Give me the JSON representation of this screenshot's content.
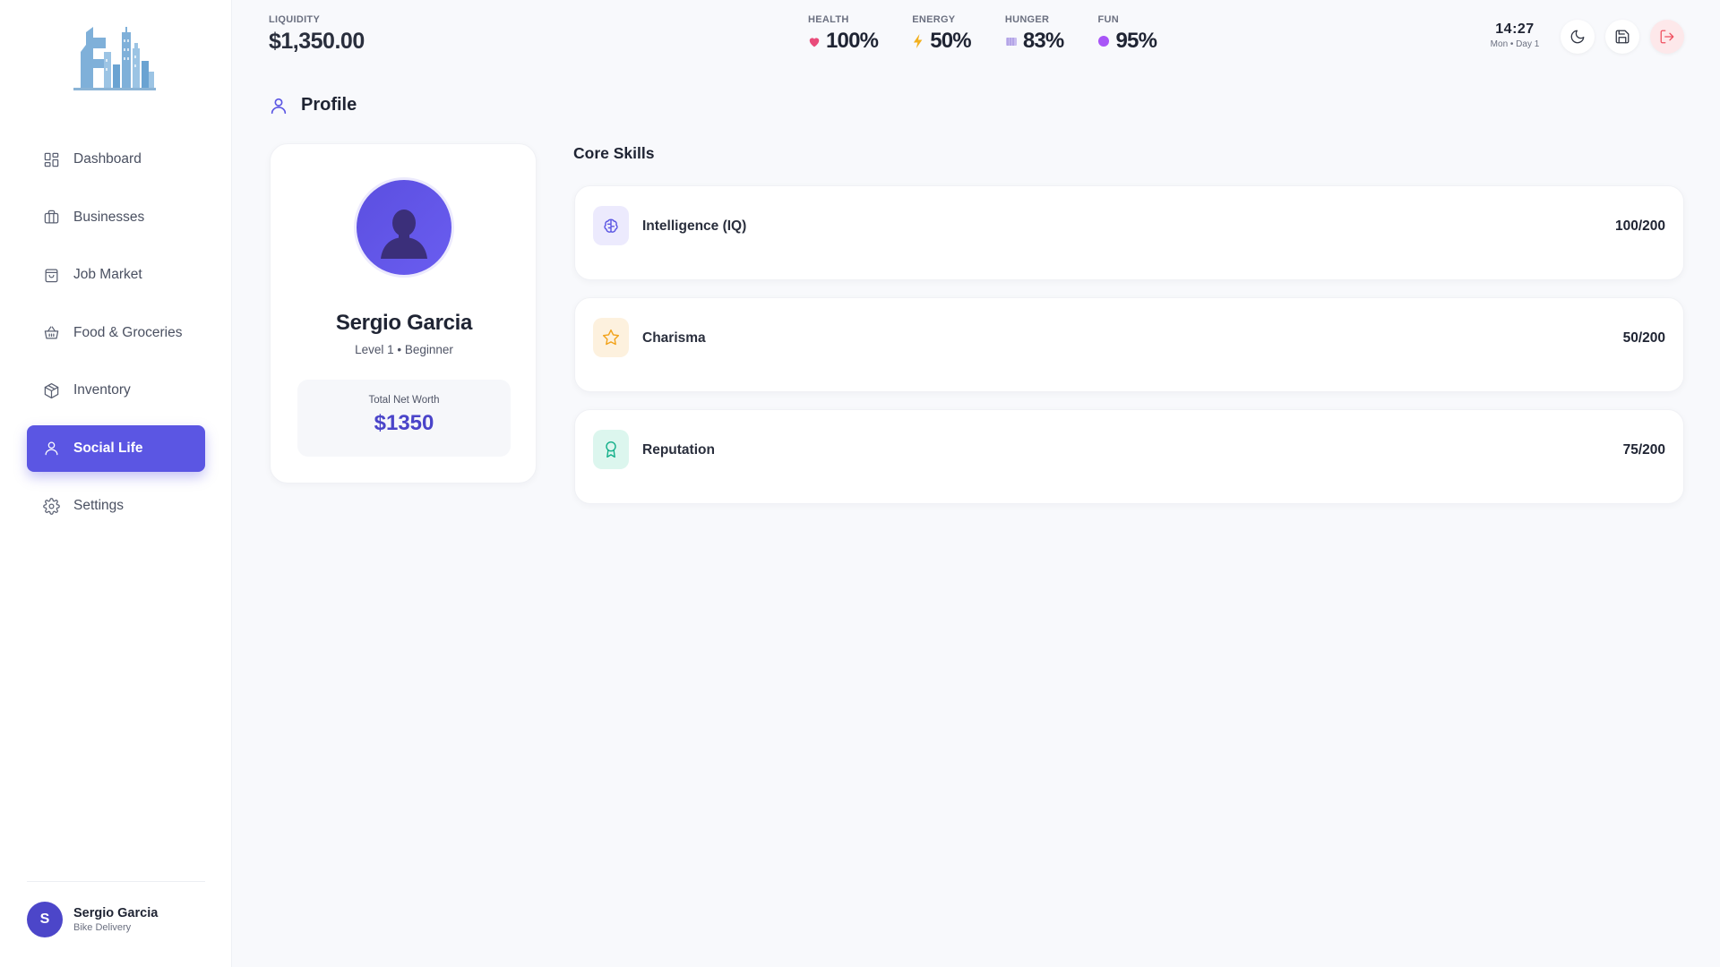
{
  "sidebar": {
    "items": [
      {
        "label": "Dashboard",
        "icon": "dashboard-icon"
      },
      {
        "label": "Businesses",
        "icon": "briefcase-icon"
      },
      {
        "label": "Job Market",
        "icon": "shopping-bag-icon"
      },
      {
        "label": "Food & Groceries",
        "icon": "basket-icon"
      },
      {
        "label": "Inventory",
        "icon": "package-icon"
      },
      {
        "label": "Social Life",
        "icon": "user-icon",
        "active": true
      },
      {
        "label": "Settings",
        "icon": "gear-icon"
      }
    ],
    "user": {
      "initial": "S",
      "name": "Sergio Garcia",
      "job": "Bike Delivery"
    }
  },
  "topbar": {
    "liquidity": {
      "label": "LIQUIDITY",
      "value": "$1,350.00"
    },
    "stats": [
      {
        "label": "HEALTH",
        "value": "100%",
        "icon": "heart-icon",
        "color": "#e94b7a"
      },
      {
        "label": "ENERGY",
        "value": "50%",
        "icon": "lightning-icon",
        "color": "#f2b01e"
      },
      {
        "label": "HUNGER",
        "value": "83%",
        "icon": "food-icon",
        "color": "#b7a7e8"
      },
      {
        "label": "FUN",
        "value": "95%",
        "icon": "circle-icon",
        "color": "#a855f7"
      }
    ],
    "clock": {
      "time": "14:27",
      "day": "Mon • Day 1"
    }
  },
  "page": {
    "title": "Profile"
  },
  "profile": {
    "name": "Sergio Garcia",
    "level": "Level 1 • Beginner",
    "net_worth_label": "Total Net Worth",
    "net_worth_value": "$1350"
  },
  "skills": {
    "title": "Core Skills",
    "items": [
      {
        "name": "Intelligence (IQ)",
        "value": "100/200",
        "icon": "brain-icon",
        "color": "#5b56e3",
        "bg": "#eceafd"
      },
      {
        "name": "Charisma",
        "value": "50/200",
        "icon": "star-icon",
        "color": "#f2a31b",
        "bg": "#fdf1de"
      },
      {
        "name": "Reputation",
        "value": "75/200",
        "icon": "award-icon",
        "color": "#14b08a",
        "bg": "#dcf6ee"
      }
    ]
  },
  "colors": {
    "accent": "#5b56e3",
    "logout": "#ef4f5f"
  }
}
